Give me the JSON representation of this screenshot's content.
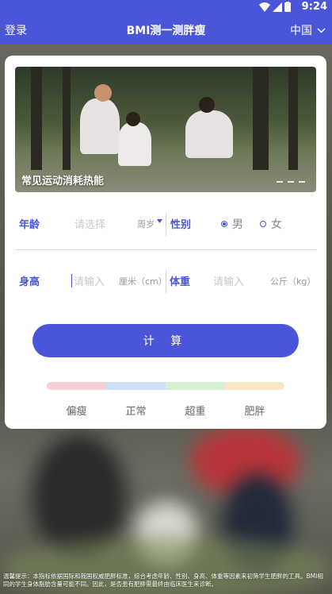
{
  "status_bar": {
    "time": "9:24"
  },
  "app_bar": {
    "login_label": "登录",
    "title": "BMI测一测胖瘦",
    "language": "中国"
  },
  "banner": {
    "caption": "常见运动消耗热能"
  },
  "form": {
    "age": {
      "label": "年龄",
      "placeholder": "请选择",
      "unit": "周岁"
    },
    "gender": {
      "label": "性别",
      "options": [
        "男",
        "女"
      ],
      "selected": "男"
    },
    "height": {
      "label": "身高",
      "placeholder": "请输入",
      "unit": "厘米（cm）"
    },
    "weight": {
      "label": "体重",
      "placeholder": "请输入",
      "unit": "公斤（kg）"
    }
  },
  "calculate_label": "计 算",
  "scale": {
    "labels": [
      "偏瘦",
      "正常",
      "超重",
      "肥胖"
    ],
    "colors": [
      "#f6d0d4",
      "#cfdff7",
      "#d5f0d3",
      "#fbe7c8"
    ]
  },
  "accent_color": "#4a55d8",
  "footnote": "温馨提示：本指标依据国际和我国权威肥胖标准，综合考虑年龄、性别、身高、体重等因素来初筛学生肥胖的工具。BMI相同的学生身体脂肪含量可能不同。因此，是否患有肥胖需最终由临床医生来诊断。"
}
